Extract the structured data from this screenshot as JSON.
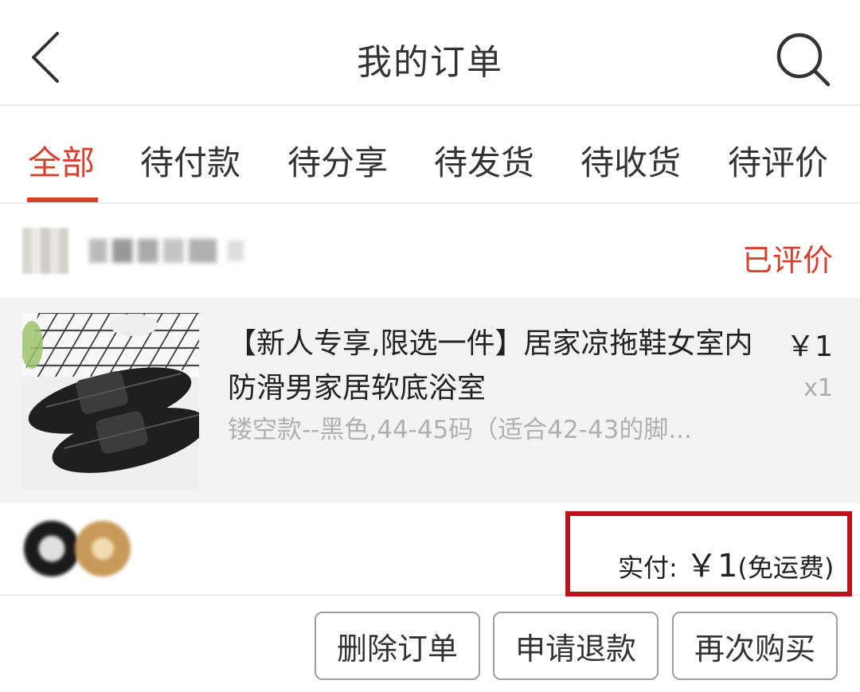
{
  "header": {
    "title": "我的订单",
    "back_icon": "chevron-left-icon",
    "search_icon": "search-icon"
  },
  "tabs": [
    {
      "label": "全部",
      "active": true
    },
    {
      "label": "待付款",
      "active": false
    },
    {
      "label": "待分享",
      "active": false
    },
    {
      "label": "待发货",
      "active": false
    },
    {
      "label": "待收货",
      "active": false
    },
    {
      "label": "待评价",
      "active": false
    }
  ],
  "order": {
    "status": "已评价",
    "product": {
      "title": "【新人专享,限选一件】居家凉拖鞋女室内防滑男家居软底浴室",
      "price": "￥1",
      "quantity": "x1",
      "sku": "镂空款--黑色,44-45码（适合42-43的脚..."
    },
    "payment": {
      "label": "实付: ",
      "amount": "￥1",
      "note": "(免运费)"
    },
    "actions": {
      "delete": "删除订单",
      "refund": "申请退款",
      "rebuy": "再次购买"
    }
  },
  "colors": {
    "accent": "#d7402f",
    "highlight_border": "#b7141c",
    "product_bg": "#f3f3f3"
  }
}
